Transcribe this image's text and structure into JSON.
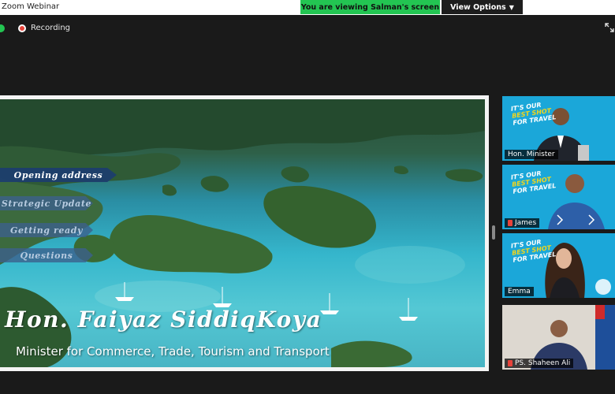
{
  "window": {
    "title": "Zoom Webinar",
    "viewing_banner": "You are viewing Salman's screen",
    "view_options_label": "View Options",
    "view_options_icon": "chevron-down-icon"
  },
  "status": {
    "recording_label": "Recording",
    "recording_color": "#e8433a",
    "shield_color": "#23c552"
  },
  "slide": {
    "agenda": [
      "Opening address",
      "Strategic Update",
      "Getting ready",
      "Questions"
    ],
    "active_agenda_index": 0,
    "speaker_name": "Hon. Faiyaz SiddiqKoya",
    "speaker_title": "Minister for Commerce, Trade, Tourism and Transport"
  },
  "branding": {
    "logo_line1": "IT'S OUR",
    "logo_line2": "BEST SHOT",
    "logo_line3": "FOR TRAVEL",
    "brand_color": "#1ba7d9",
    "accent_color": "#f1d51d"
  },
  "participants": [
    {
      "name": "Hon. Minister",
      "muted": false,
      "speaking": false
    },
    {
      "name": "James",
      "muted": true,
      "speaking": false
    },
    {
      "name": "Emma",
      "muted": false,
      "speaking": true
    },
    {
      "name": "PS. Shaheen Ali",
      "muted": true,
      "speaking": false
    }
  ]
}
